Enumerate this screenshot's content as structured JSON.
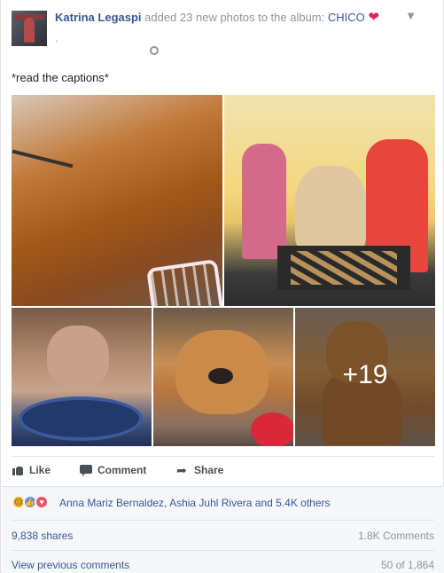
{
  "post": {
    "author": "Katrina Legaspi",
    "action_text": "added 23 new photos to the album:",
    "album": "CHICO",
    "heart": "❤",
    "meta_dot": ".",
    "caption": "*read the captions*",
    "more_photos": "+19"
  },
  "actions": {
    "like": "Like",
    "comment": "Comment",
    "share": "Share"
  },
  "reactions": {
    "types": [
      "sad",
      "like",
      "love"
    ],
    "names": "Anna Mariz Bernaldez, Ashia Juhl Rivera and 5.4K others"
  },
  "stats": {
    "shares": "9,838 shares",
    "comments": "1.8K Comments",
    "view_previous": "View previous comments",
    "comment_count": "50 of 1,864"
  },
  "colors": {
    "link": "#365899",
    "heart": "#e0245e",
    "sad": "#f7b125",
    "like": "#5890ff",
    "love": "#f25268"
  }
}
